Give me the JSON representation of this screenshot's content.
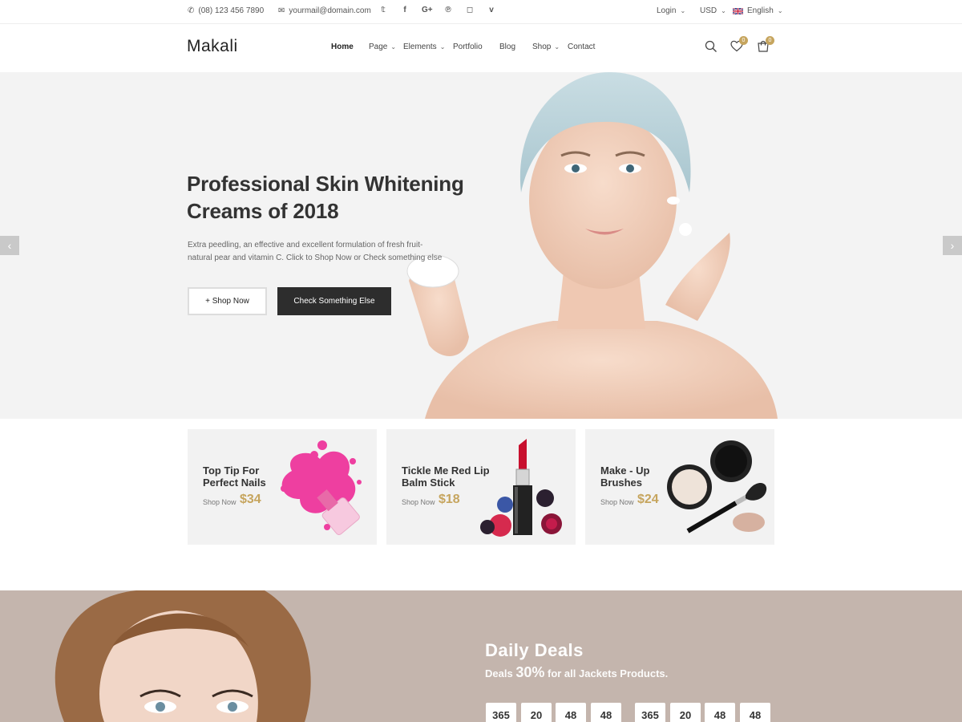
{
  "topbar": {
    "phone": "(08) 123 456 7890",
    "email": "yourmail@domain.com",
    "social": [
      "twitter-icon",
      "facebook-icon",
      "google-plus-icon",
      "pinterest-icon",
      "instagram-icon",
      "vimeo-icon"
    ],
    "social_glyphs": [
      "𝕥",
      "f",
      "G+",
      "℗",
      "◻",
      "v"
    ],
    "login": "Login",
    "currency": "USD",
    "language": "English"
  },
  "header": {
    "logo": "Makali",
    "nav": [
      "Home",
      "Page",
      "Elements",
      "Portfolio",
      "Blog",
      "Shop",
      "Contact"
    ],
    "wishlist_count": "0",
    "cart_count": "0"
  },
  "hero": {
    "title": "Professional Skin Whitening Creams of 2018",
    "description": "Extra peedling, an effective and excellent formulation of fresh fruit-natural pear and vitamin C. Click to Shop Now or Check something else",
    "btn_shop": "+ Shop Now",
    "btn_check": "Check Something Else"
  },
  "promos": [
    {
      "title": "Top Tip For Perfect Nails",
      "shop": "Shop Now",
      "price": "$34",
      "image": "nail-polish-image"
    },
    {
      "title": "Tickle Me Red Lip Balm Stick",
      "shop": "Shop Now",
      "price": "$18",
      "image": "lipstick-image"
    },
    {
      "title": "Make - Up Brushes",
      "shop": "Shop Now",
      "price": "$24",
      "image": "makeup-brush-image"
    }
  ],
  "deals": {
    "title": "Daily Deals",
    "sub_prefix": "Deals",
    "sub_pct": "30%",
    "sub_suffix": "for all Jackets Products.",
    "countdown": [
      "365",
      "20",
      "48",
      "48",
      "365",
      "20",
      "48",
      "48"
    ]
  },
  "colors": {
    "accent": "#c6a55e",
    "dark_button": "#2d2d2d",
    "deals_bg": "#c4b5ad"
  }
}
